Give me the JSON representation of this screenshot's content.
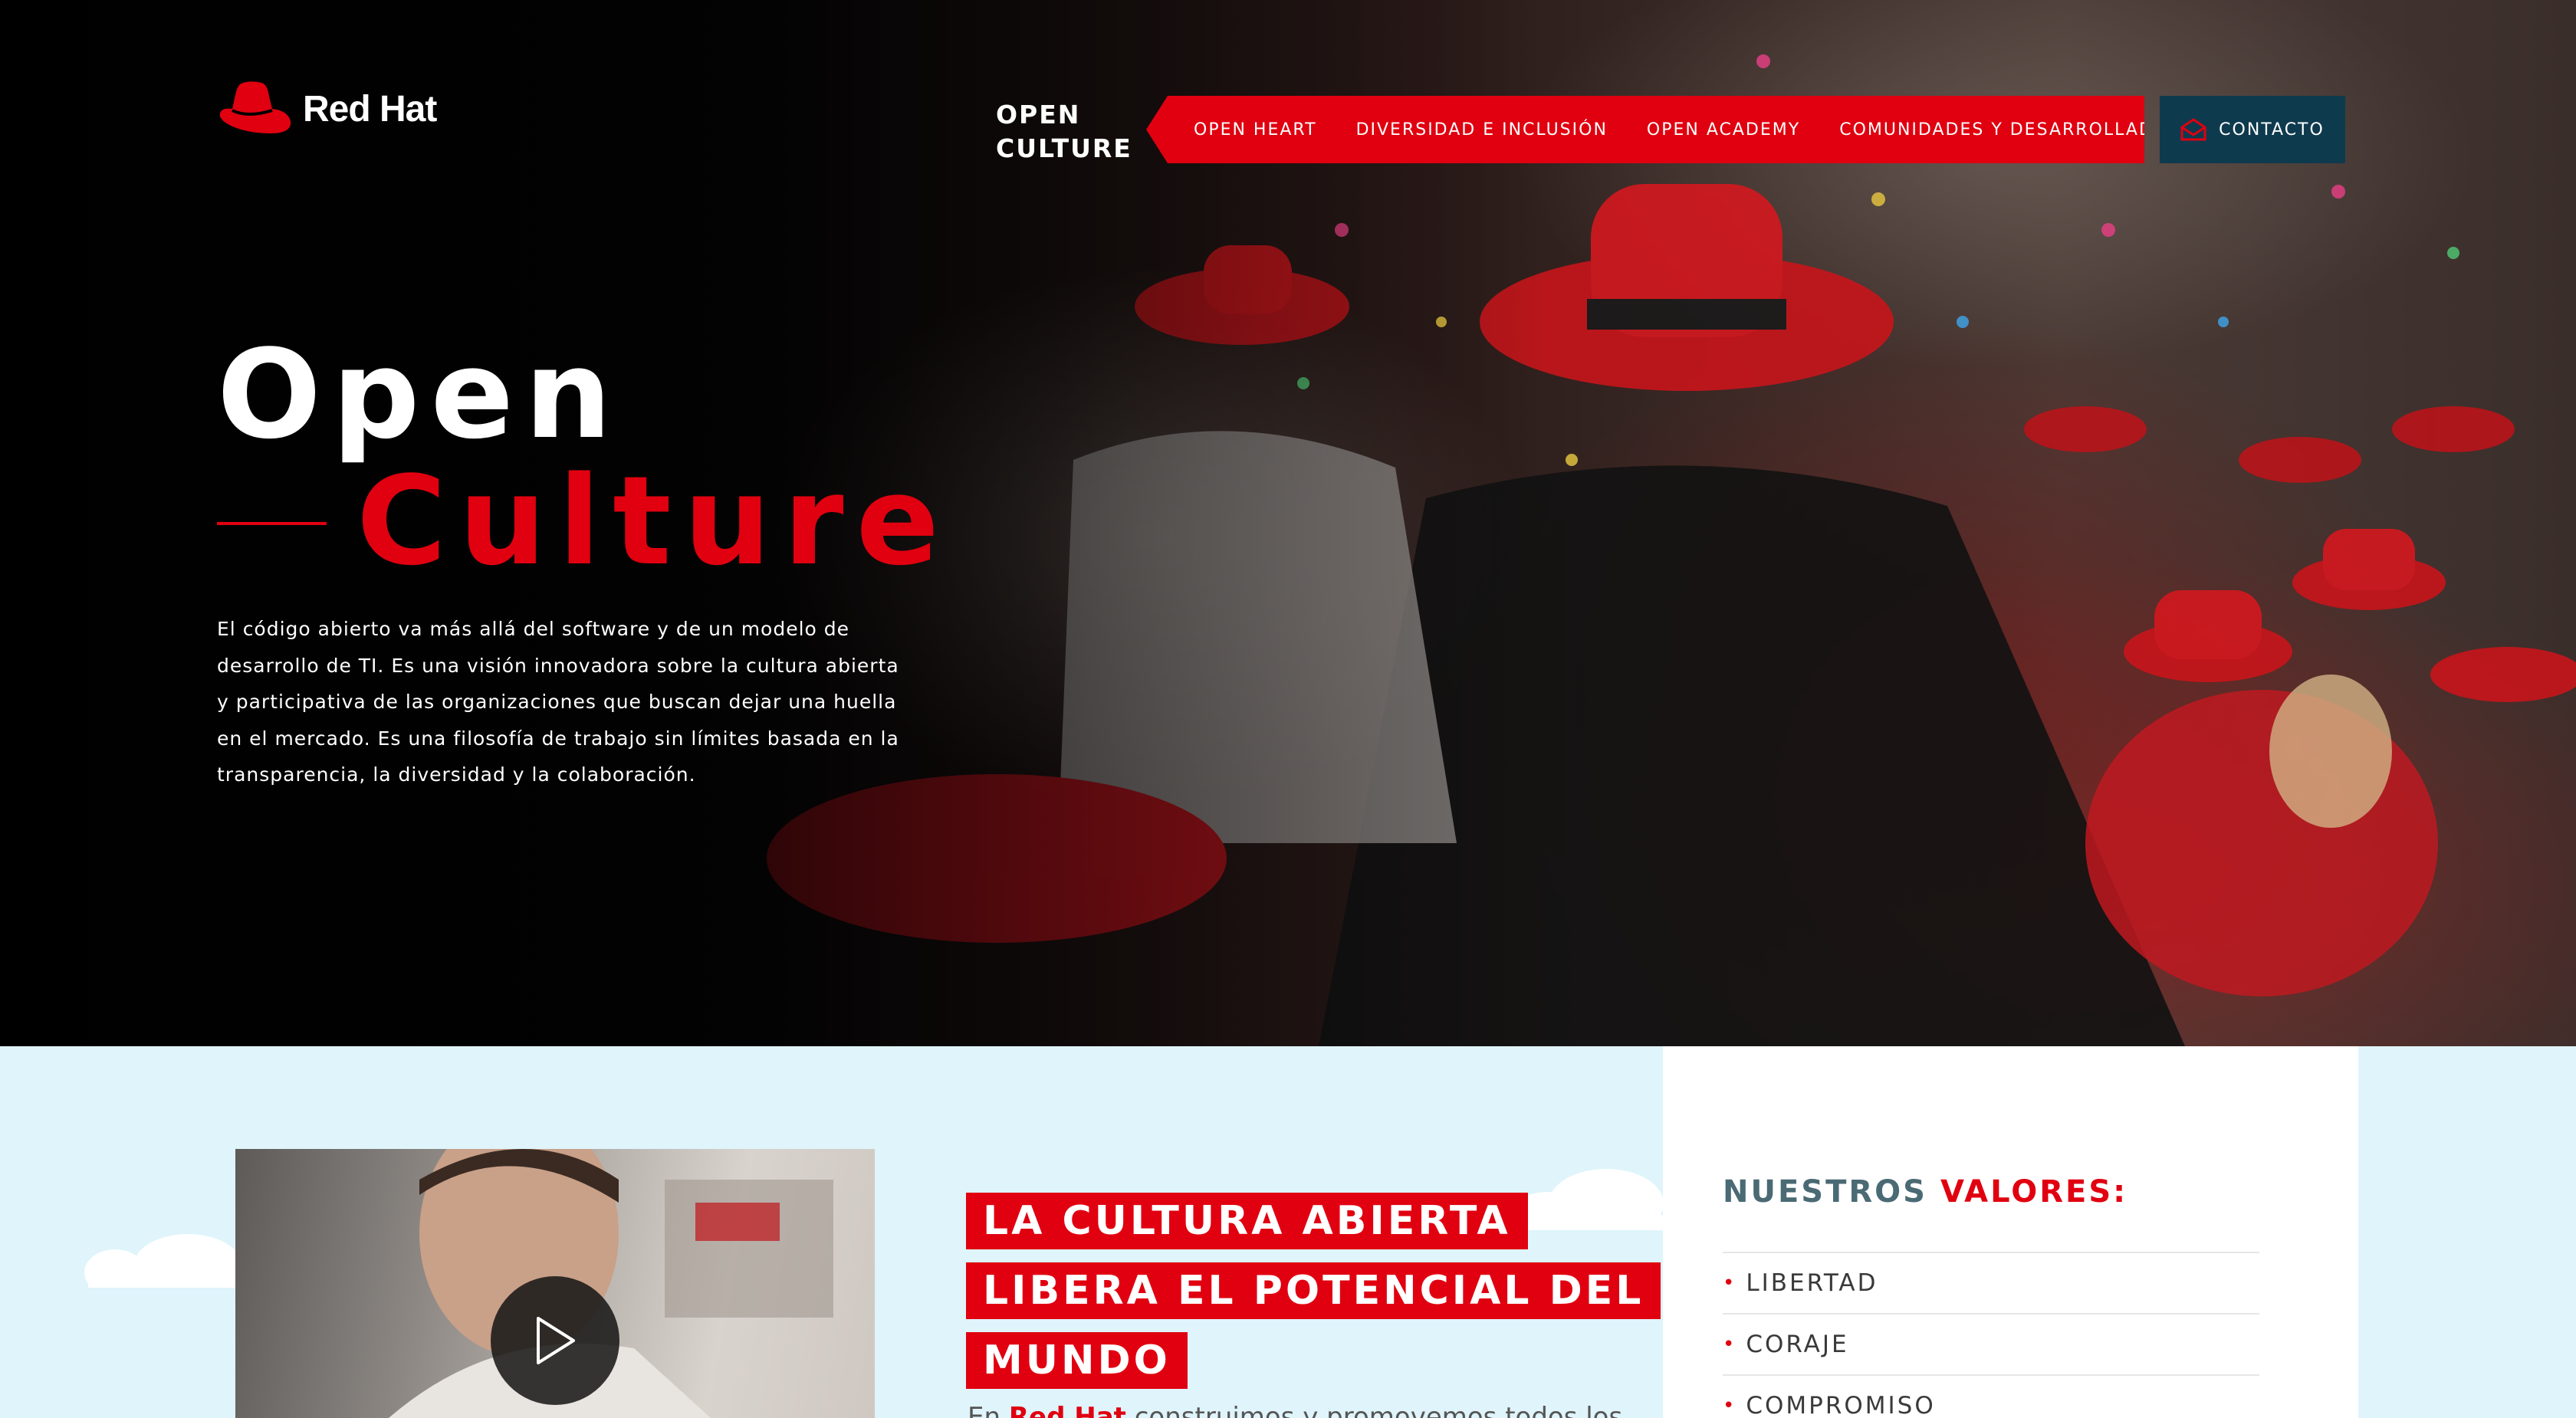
{
  "brand": {
    "name": "Red Hat",
    "accent_color": "#e00010",
    "dark_blue": "#0e3a4e"
  },
  "nav": {
    "section_label_line1": "OPEN",
    "section_label_line2": "CULTURE",
    "items": [
      {
        "label": "OPEN HEART"
      },
      {
        "label": "DIVERSIDAD E INCLUSIÓN"
      },
      {
        "label": "OPEN ACADEMY"
      },
      {
        "label": "COMUNIDADES Y DESARROLLADORES"
      }
    ],
    "contact": {
      "label": "CONTACTO",
      "icon": "contact-icon"
    }
  },
  "hero": {
    "title_line1": "Open",
    "title_line2": "Culture",
    "description": "El código abierto va más allá del software y de un modelo de desarrollo de TI. Es una visión innovadora sobre la cultura abierta y participativa de las organizaciones que buscan dejar una huella en el mercado. Es una filosofía de trabajo sin límites basada en la transparencia, la diversidad y la colaboración."
  },
  "video": {
    "play_icon": "play-icon"
  },
  "headline": {
    "lines": [
      "LA CULTURA ABIERTA",
      "LIBERA EL POTENCIAL DEL",
      "MUNDO"
    ]
  },
  "body": {
    "prefix": "En",
    "brand": "Red Hat",
    "rest": "construimos y promovemos todos los"
  },
  "values": {
    "title_part1": "NUESTROS",
    "title_part2": "VALORES:",
    "items": [
      "LIBERTAD",
      "CORAJE",
      "COMPROMISO"
    ]
  }
}
